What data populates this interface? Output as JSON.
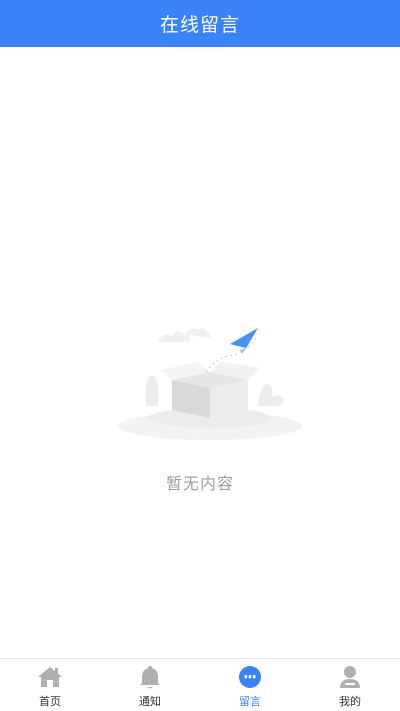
{
  "header": {
    "title": "在线留言"
  },
  "empty_state": {
    "message": "暂无内容",
    "illustration": "empty-box-with-paper-plane"
  },
  "tabbar": {
    "items": [
      {
        "label": "首页",
        "icon": "home-icon",
        "active": false
      },
      {
        "label": "通知",
        "icon": "bell-icon",
        "active": false
      },
      {
        "label": "留言",
        "icon": "message-bubble-icon",
        "active": true
      },
      {
        "label": "我的",
        "icon": "user-icon",
        "active": false
      }
    ]
  },
  "colors": {
    "primary": "#3a82f7",
    "inactive_icon": "#b0b0b0",
    "empty_text": "#9e9e9e"
  }
}
